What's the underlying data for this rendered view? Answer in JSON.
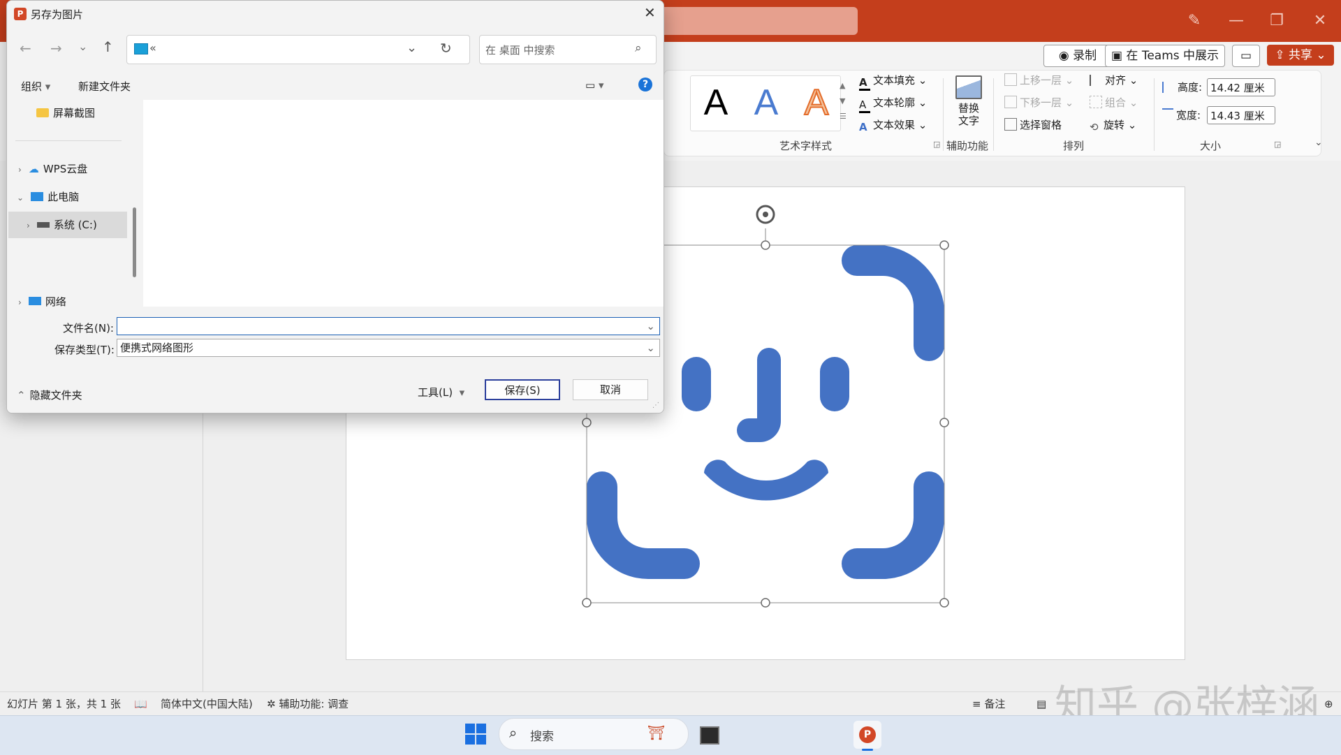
{
  "ppt": {
    "top_buttons": {
      "record": "录制",
      "teams": "在 Teams 中展示",
      "share": "共享"
    },
    "ribbon": {
      "wordart_letters": [
        "A",
        "A",
        "A"
      ],
      "text_fill": "文本填充",
      "text_outline": "文本轮廓",
      "text_effects": "文本效果",
      "wordart_group": "艺术字样式",
      "alt_text_line1": "替换",
      "alt_text_line2": "文字",
      "accessibility_group": "辅助功能",
      "bring_forward": "上移一层",
      "send_backward": "下移一层",
      "selection_pane": "选择窗格",
      "align": "对齐",
      "group": "组合",
      "rotate": "旋转",
      "arrange_group": "排列",
      "height_label": "高度:",
      "height_value": "14.42 厘米",
      "width_label": "宽度:",
      "width_value": "14.43 厘米",
      "size_group": "大小"
    },
    "status": {
      "slide_info": "幻灯片 第 1 张，共 1 张",
      "language": "简体中文(中国大陆)",
      "accessibility": "辅助功能: 调查",
      "notes": "备注"
    },
    "watermark": "知乎 @张梓涵"
  },
  "taskbar": {
    "search_placeholder": "搜索"
  },
  "dialog": {
    "title": "另存为图片",
    "address_text": "«",
    "search_placeholder": "在 桌面 中搜索",
    "organize": "组织",
    "new_folder": "新建文件夹",
    "nav_items": {
      "screenshots": "屏幕截图",
      "wps_cloud": "WPS云盘",
      "this_pc": "此电脑",
      "system_c": "系统 (C:)",
      "network": "网络"
    },
    "filename_label": "文件名(N):",
    "filename_value": "",
    "filetype_label": "保存类型(T):",
    "filetype_value": "便携式网络图形",
    "hide_folders": "隐藏文件夹",
    "tools": "工具(L)",
    "save": "保存(S)",
    "cancel": "取消"
  },
  "colors": {
    "ppt_accent": "#c43e1c",
    "shape_fill": "#4472c4",
    "primary_button_border": "#2b3f9c"
  }
}
